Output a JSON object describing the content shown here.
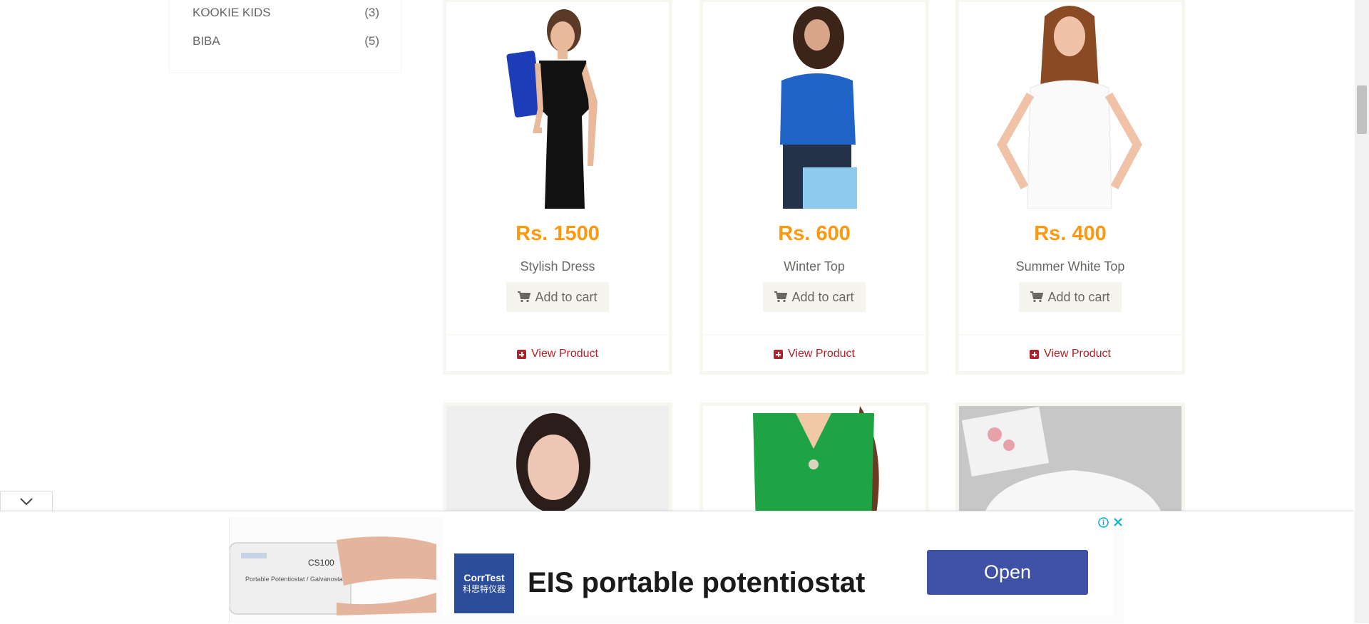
{
  "brands": [
    {
      "name": "KOOKIE KIDS",
      "count": "(3)"
    },
    {
      "name": "BIBA",
      "count": "(5)"
    }
  ],
  "products": [
    {
      "price": "Rs. 1500",
      "name": "Stylish Dress",
      "cart_label": "Add to cart",
      "view_label": "View Product"
    },
    {
      "price": "Rs. 600",
      "name": "Winter Top",
      "cart_label": "Add to cart",
      "view_label": "View Product"
    },
    {
      "price": "Rs. 400",
      "name": "Summer White Top",
      "cart_label": "Add to cart",
      "view_label": "View Product"
    }
  ],
  "ad": {
    "headline": "EIS portable potentiostat",
    "brand_line1": "CorrTest",
    "brand_line2": "科思特仪器",
    "button_label": "Open",
    "device_model": "CS100",
    "device_text": "Portable Potentiostat / Galvanostat"
  },
  "colors": {
    "price": "#fe980f",
    "view_link": "#b12229",
    "ad_button": "#3f51a4"
  },
  "icons": {
    "cart": "shopping-cart-icon",
    "view": "plus-square-icon",
    "ad_info": "info-icon",
    "ad_close": "close-icon",
    "collapse": "chevron-down-icon"
  }
}
